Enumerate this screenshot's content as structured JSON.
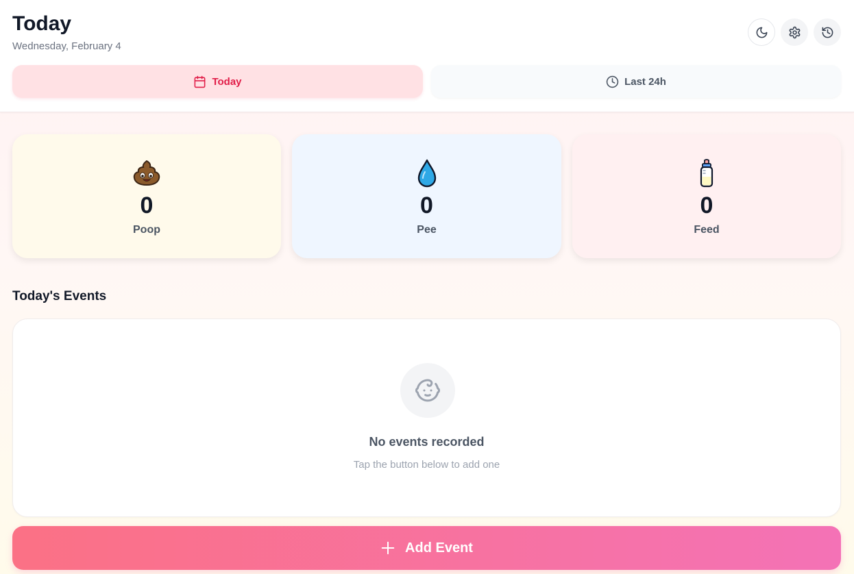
{
  "header": {
    "title": "Today",
    "date": "Wednesday, February 4"
  },
  "tabs": [
    {
      "label": "Today",
      "icon": "calendar-icon",
      "active": true
    },
    {
      "label": "Last 24h",
      "icon": "clock-icon",
      "active": false
    }
  ],
  "stats": [
    {
      "label": "Poop",
      "count": "0",
      "icon": "poop-emoji-icon"
    },
    {
      "label": "Pee",
      "count": "0",
      "icon": "water-drop-icon"
    },
    {
      "label": "Feed",
      "count": "0",
      "icon": "baby-bottle-icon"
    }
  ],
  "events": {
    "section_title": "Today's Events",
    "empty_title": "No events recorded",
    "empty_subtitle": "Tap the button below to add one",
    "empty_icon": "baby-face-icon"
  },
  "add_button": {
    "label": "Add Event",
    "icon": "plus-icon"
  },
  "colors": {
    "accent": "#e11d48",
    "add_gradient_start": "#fb7185",
    "add_gradient_end": "#f472b6",
    "poop_card": "#fffaeb",
    "pee_card": "#eff6ff",
    "feed_card": "#fff0f1"
  }
}
